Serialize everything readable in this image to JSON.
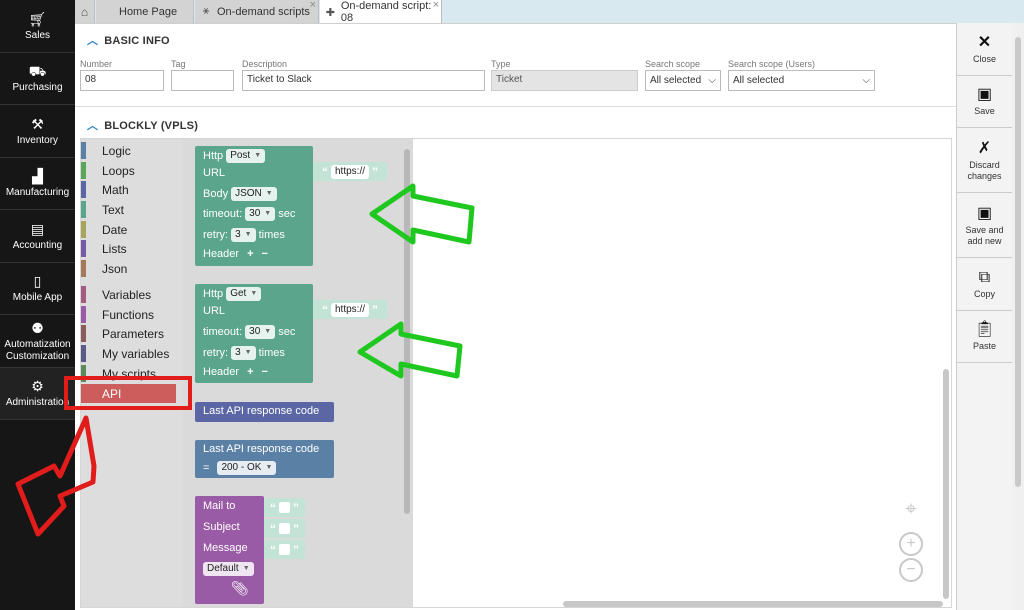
{
  "nav": {
    "items": [
      {
        "label": "Sales",
        "icon": "cart-icon"
      },
      {
        "label": "Purchasing",
        "icon": "truck-icon"
      },
      {
        "label": "Inventory",
        "icon": "forklift-icon"
      },
      {
        "label": "Manufacturing",
        "icon": "factory-icon"
      },
      {
        "label": "Accounting",
        "icon": "ledger-icon"
      },
      {
        "label": "Mobile App",
        "icon": "phone-icon"
      },
      {
        "label": "Automatization Customization",
        "icon": "robot-icon"
      },
      {
        "label": "Administration",
        "icon": "gear-icon"
      }
    ]
  },
  "tabs": [
    {
      "label": "Home Page",
      "icon": "home-icon"
    },
    {
      "label": "On-demand scripts",
      "icon": "script-icon"
    },
    {
      "label": "On-demand script: 08",
      "icon": "puzzle-icon"
    }
  ],
  "basic_info": {
    "header": "BASIC INFO",
    "number": {
      "label": "Number",
      "value": "08"
    },
    "tag": {
      "label": "Tag",
      "value": ""
    },
    "description": {
      "label": "Description",
      "value": "Ticket to Slack"
    },
    "type": {
      "label": "Type",
      "value": "Ticket"
    },
    "search_scope": {
      "label": "Search scope",
      "value": "All selected"
    },
    "search_scope_users": {
      "label": "Search scope (Users)",
      "value": "All selected"
    }
  },
  "blockly": {
    "header": "BLOCKLY (VPLS)",
    "categories": [
      {
        "label": "Logic",
        "color": "#5b80a5"
      },
      {
        "label": "Loops",
        "color": "#5ba55b"
      },
      {
        "label": "Math",
        "color": "#5b67a5"
      },
      {
        "label": "Text",
        "color": "#5ba58c"
      },
      {
        "label": "Date",
        "color": "#a5a55b"
      },
      {
        "label": "Lists",
        "color": "#745ba5"
      },
      {
        "label": "Json",
        "color": "#a57a5b"
      },
      {
        "label": "Variables",
        "color": "#a55b80"
      },
      {
        "label": "Functions",
        "color": "#995ba5"
      },
      {
        "label": "Parameters",
        "color": "#8a5b5b"
      },
      {
        "label": "My variables",
        "color": "#5b5b8a"
      },
      {
        "label": "My scripts",
        "color": "#5b8a5b"
      },
      {
        "label": "API",
        "color": "#cd5c5c"
      }
    ],
    "http_post": {
      "http": "Http",
      "method": "Post",
      "url": "URL",
      "url_value": "https://",
      "body": "Body",
      "body_type": "JSON",
      "timeout": "timeout:",
      "timeout_value": "30",
      "sec": "sec",
      "retry": "retry:",
      "retry_value": "3",
      "times": "times",
      "header": "Header",
      "plus": "+",
      "minus": "−"
    },
    "http_get": {
      "http": "Http",
      "method": "Get",
      "url": "URL",
      "url_value": "https://",
      "timeout": "timeout:",
      "timeout_value": "30",
      "sec": "sec",
      "retry": "retry:",
      "retry_value": "3",
      "times": "times",
      "header": "Header",
      "plus": "+",
      "minus": "−"
    },
    "last_code": "Last API response code",
    "last_code_eq": {
      "label": "Last API response code",
      "op": "=",
      "value": "200 - OK"
    },
    "mail": {
      "mail_to": "Mail to",
      "subject": "Subject",
      "message": "Message",
      "default": "Default"
    },
    "quote_open": "“",
    "quote_close": "”"
  },
  "zoom": {
    "plus": "+",
    "minus": "−"
  },
  "toolbar": [
    {
      "label": "Close",
      "icon": "close-icon"
    },
    {
      "label": "Save",
      "icon": "save-icon"
    },
    {
      "label": "Discard changes",
      "icon": "discard-icon"
    },
    {
      "label": "Save and add new",
      "icon": "save-add-icon"
    },
    {
      "label": "Copy",
      "icon": "copy-icon"
    },
    {
      "label": "Paste",
      "icon": "paste-icon"
    }
  ],
  "colors": {
    "nav_bg": "#161616",
    "accent": "#2e87c8",
    "http_block": "#5ba58c",
    "api_block": "#5b67a5",
    "mail_block": "#995ba5",
    "annotation_green": "#1fc81f",
    "annotation_red": "#e21b1b"
  }
}
